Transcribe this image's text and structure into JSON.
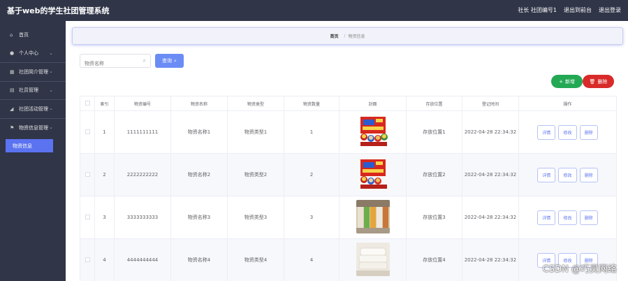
{
  "header": {
    "title": "基于web的学生社团管理系统",
    "user_label": "社长 社团编号1",
    "to_frontend": "退出到前台",
    "logout": "退出登录"
  },
  "sidebar": {
    "items": [
      {
        "label": "首页",
        "icon": "home-icon"
      },
      {
        "label": "个人中心",
        "icon": "user-icon"
      },
      {
        "label": "社团简介管理",
        "icon": "grid-icon"
      },
      {
        "label": "社员管理",
        "icon": "list-icon"
      },
      {
        "label": "社团活动管理",
        "icon": "chart-icon"
      },
      {
        "label": "物资信息管理",
        "icon": "flag-icon"
      }
    ],
    "active_sub": "物资信息"
  },
  "breadcrumb": {
    "home": "首页",
    "sep": "/",
    "current": "物资信息"
  },
  "search": {
    "placeholder": "物资名称",
    "button": "查询"
  },
  "actions": {
    "add": "新增",
    "delete": "删除"
  },
  "table": {
    "headers": [
      "",
      "索引",
      "物资编号",
      "物资名称",
      "物资类型",
      "物资数量",
      "封面",
      "存放位置",
      "登记时间",
      "操作"
    ],
    "ops": [
      "详情",
      "修改",
      "删除"
    ],
    "rows": [
      {
        "idx": "1",
        "code": "1111111111",
        "name": "物资名称1",
        "type": "物资类型1",
        "qty": "1",
        "image": "instant-noodle-box",
        "loc": "存放位置1",
        "time": "2022-04-28 22:34:32"
      },
      {
        "idx": "2",
        "code": "2222222222",
        "name": "物资名称2",
        "type": "物资类型2",
        "qty": "2",
        "image": "instant-noodle-box",
        "loc": "存放位置2",
        "time": "2022-04-28 22:34:32"
      },
      {
        "idx": "3",
        "code": "3333333333",
        "name": "物资名称3",
        "type": "物资类型3",
        "qty": "3",
        "image": "paper-towel-rolls",
        "loc": "存放位置3",
        "time": "2022-04-28 22:34:32"
      },
      {
        "idx": "4",
        "code": "4444444444",
        "name": "物资名称4",
        "type": "物资类型4",
        "qty": "4",
        "image": "folded-towels",
        "loc": "存放位置4",
        "time": "2022-04-28 22:34:32"
      }
    ]
  },
  "watermark": "CSDN @巧灵网络",
  "colors": {
    "sidebar": "#303548",
    "accent": "#5b73f0",
    "add": "#23a854",
    "delete": "#d92a2a"
  }
}
